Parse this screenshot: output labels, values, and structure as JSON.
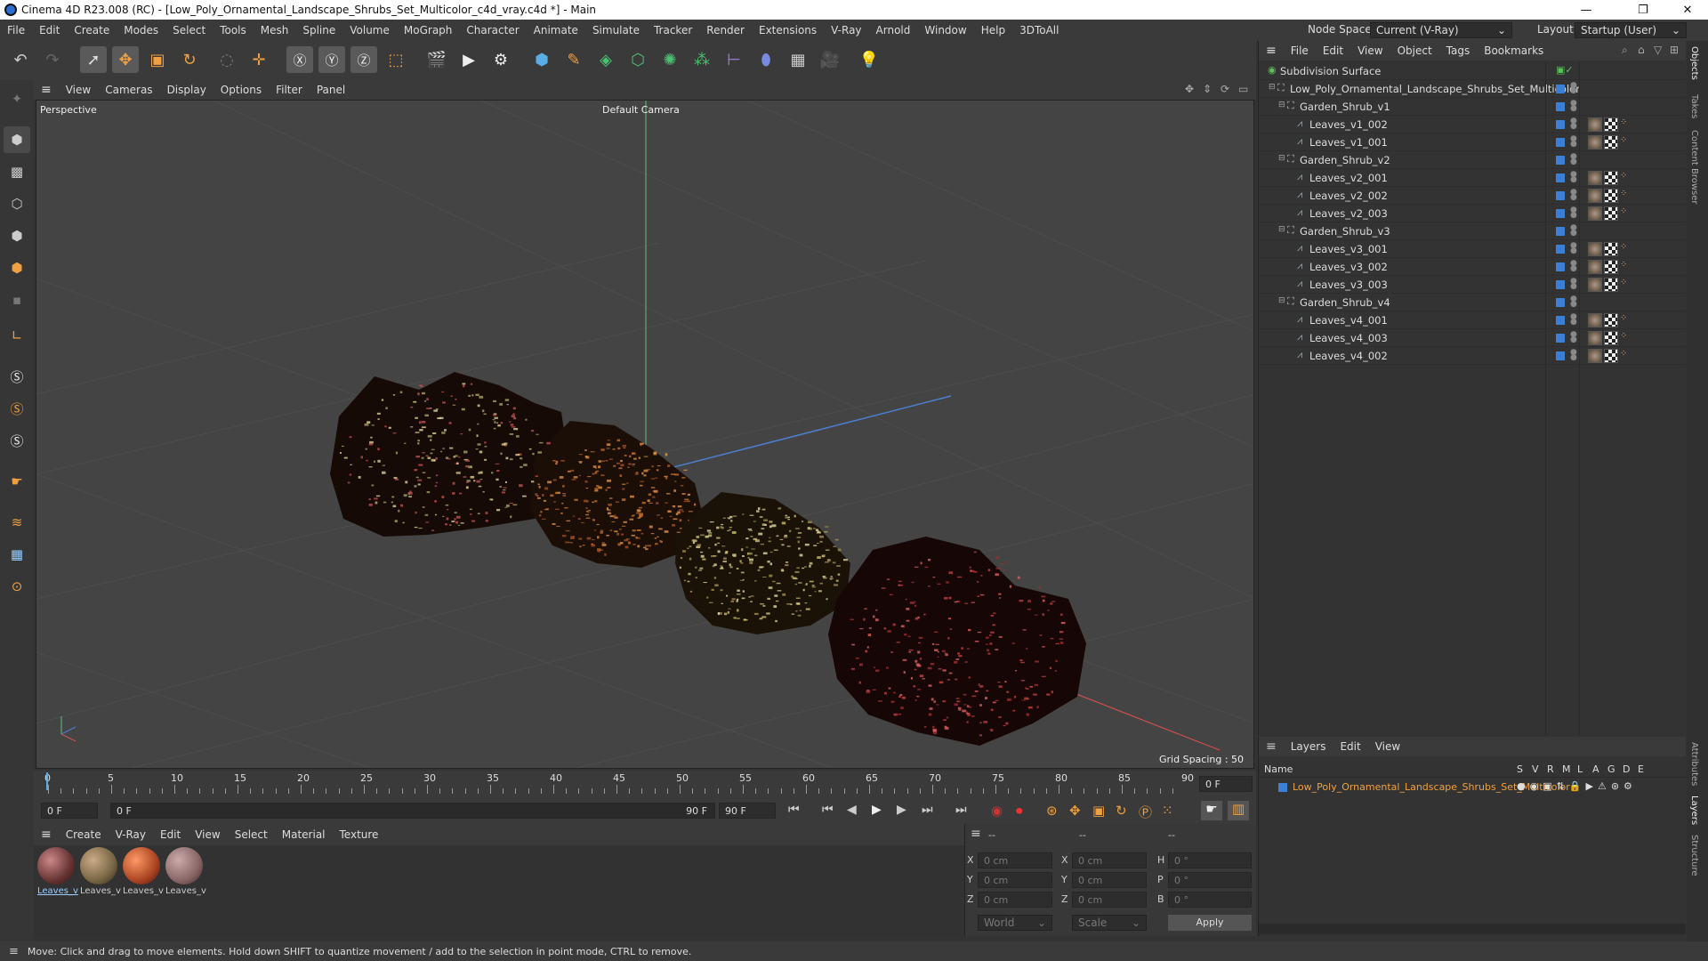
{
  "window": {
    "title": "Cinema 4D R23.008 (RC) - [Low_Poly_Ornamental_Landscape_Shrubs_Set_Multicolor_c4d_vray.c4d *] - Main",
    "minimize": "—",
    "maximize": "❐",
    "close": "✕"
  },
  "menu": {
    "items": [
      "File",
      "Edit",
      "Create",
      "Modes",
      "Select",
      "Tools",
      "Mesh",
      "Spline",
      "Volume",
      "MoGraph",
      "Character",
      "Animate",
      "Simulate",
      "Tracker",
      "Render",
      "Extensions",
      "V-Ray",
      "Arnold",
      "Window",
      "Help",
      "3DToAll"
    ],
    "node_space_label": "Node Space:",
    "node_space_value": "Current (V-Ray)",
    "layout_label": "Layout:",
    "layout_value": "Startup (User)"
  },
  "viewport": {
    "menu": [
      "View",
      "Cameras",
      "Display",
      "Options",
      "Filter",
      "Panel"
    ],
    "name": "Perspective",
    "camera": "Default Camera",
    "grid_spacing": "Grid Spacing : 50 cm"
  },
  "timeline": {
    "ticks": [
      "0",
      "5",
      "10",
      "15",
      "20",
      "25",
      "30",
      "35",
      "40",
      "45",
      "50",
      "55",
      "60",
      "65",
      "70",
      "75",
      "80",
      "85",
      "90"
    ],
    "current_frame": "0 F",
    "start": "0 F",
    "range_start": "0 F",
    "range_end": "90 F",
    "end": "90 F"
  },
  "materials": {
    "menu": [
      "Create",
      "V-Ray",
      "Edit",
      "View",
      "Select",
      "Material",
      "Texture"
    ],
    "items": [
      {
        "label": "Leaves_v"
      },
      {
        "label": "Leaves_v"
      },
      {
        "label": "Leaves_v"
      },
      {
        "label": "Leaves_v"
      }
    ]
  },
  "coords": {
    "headers": [
      "--",
      "--",
      "--"
    ],
    "rows": [
      {
        "a": "X",
        "av": "0 cm",
        "b": "X",
        "bv": "0 cm",
        "c": "H",
        "cv": "0 °"
      },
      {
        "a": "Y",
        "av": "0 cm",
        "b": "Y",
        "bv": "0 cm",
        "c": "P",
        "cv": "0 °"
      },
      {
        "a": "Z",
        "av": "0 cm",
        "b": "Z",
        "bv": "0 cm",
        "c": "B",
        "cv": "0 °"
      }
    ],
    "world": "World",
    "scale": "Scale",
    "apply": "Apply"
  },
  "objects": {
    "menu": [
      "File",
      "Edit",
      "View",
      "Object",
      "Tags",
      "Bookmarks"
    ],
    "rows": [
      {
        "name": "Subdivision Surface",
        "level": 0,
        "tags": 0,
        "color": "#5bc05b"
      },
      {
        "name": "Low_Poly_Ornamental_Landscape_Shrubs_Set_Multicolor",
        "level": 1,
        "tags": 0,
        "color": "#bbb"
      },
      {
        "name": "Garden_Shrub_v1",
        "level": 2,
        "tags": 0,
        "color": "#bbb"
      },
      {
        "name": "Leaves_v1_002",
        "level": 3,
        "tags": 3,
        "color": "#8ab"
      },
      {
        "name": "Leaves_v1_001",
        "level": 3,
        "tags": 3,
        "color": "#8ab"
      },
      {
        "name": "Garden_Shrub_v2",
        "level": 2,
        "tags": 0,
        "color": "#bbb"
      },
      {
        "name": "Leaves_v2_001",
        "level": 3,
        "tags": 3,
        "color": "#8ab"
      },
      {
        "name": "Leaves_v2_002",
        "level": 3,
        "tags": 3,
        "color": "#8ab"
      },
      {
        "name": "Leaves_v2_003",
        "level": 3,
        "tags": 3,
        "color": "#8ab"
      },
      {
        "name": "Garden_Shrub_v3",
        "level": 2,
        "tags": 0,
        "color": "#bbb"
      },
      {
        "name": "Leaves_v3_001",
        "level": 3,
        "tags": 3,
        "color": "#8ab"
      },
      {
        "name": "Leaves_v3_002",
        "level": 3,
        "tags": 3,
        "color": "#8ab"
      },
      {
        "name": "Leaves_v3_003",
        "level": 3,
        "tags": 3,
        "color": "#8ab"
      },
      {
        "name": "Garden_Shrub_v4",
        "level": 2,
        "tags": 0,
        "color": "#bbb"
      },
      {
        "name": "Leaves_v4_001",
        "level": 3,
        "tags": 3,
        "color": "#8ab"
      },
      {
        "name": "Leaves_v4_003",
        "level": 3,
        "tags": 3,
        "color": "#8ab"
      },
      {
        "name": "Leaves_v4_002",
        "level": 3,
        "tags": 3,
        "color": "#8ab"
      }
    ]
  },
  "layers": {
    "menu": [
      "Layers",
      "Edit",
      "View"
    ],
    "col_name": "Name",
    "flags": [
      "S",
      "V",
      "R",
      "M",
      "L",
      "A",
      "G",
      "D",
      "E"
    ],
    "layer_name": "Low_Poly_Ornamental_Landscape_Shrubs_Set_Multicolor",
    "layer_color": "#f0a040"
  },
  "side_tabs": [
    "Objects",
    "Takes",
    "Content Browser",
    "Attributes",
    "Layers",
    "Structure"
  ],
  "status": "Move: Click and drag to move elements. Hold down SHIFT to quantize movement / add to the selection in point mode, CTRL to remove."
}
